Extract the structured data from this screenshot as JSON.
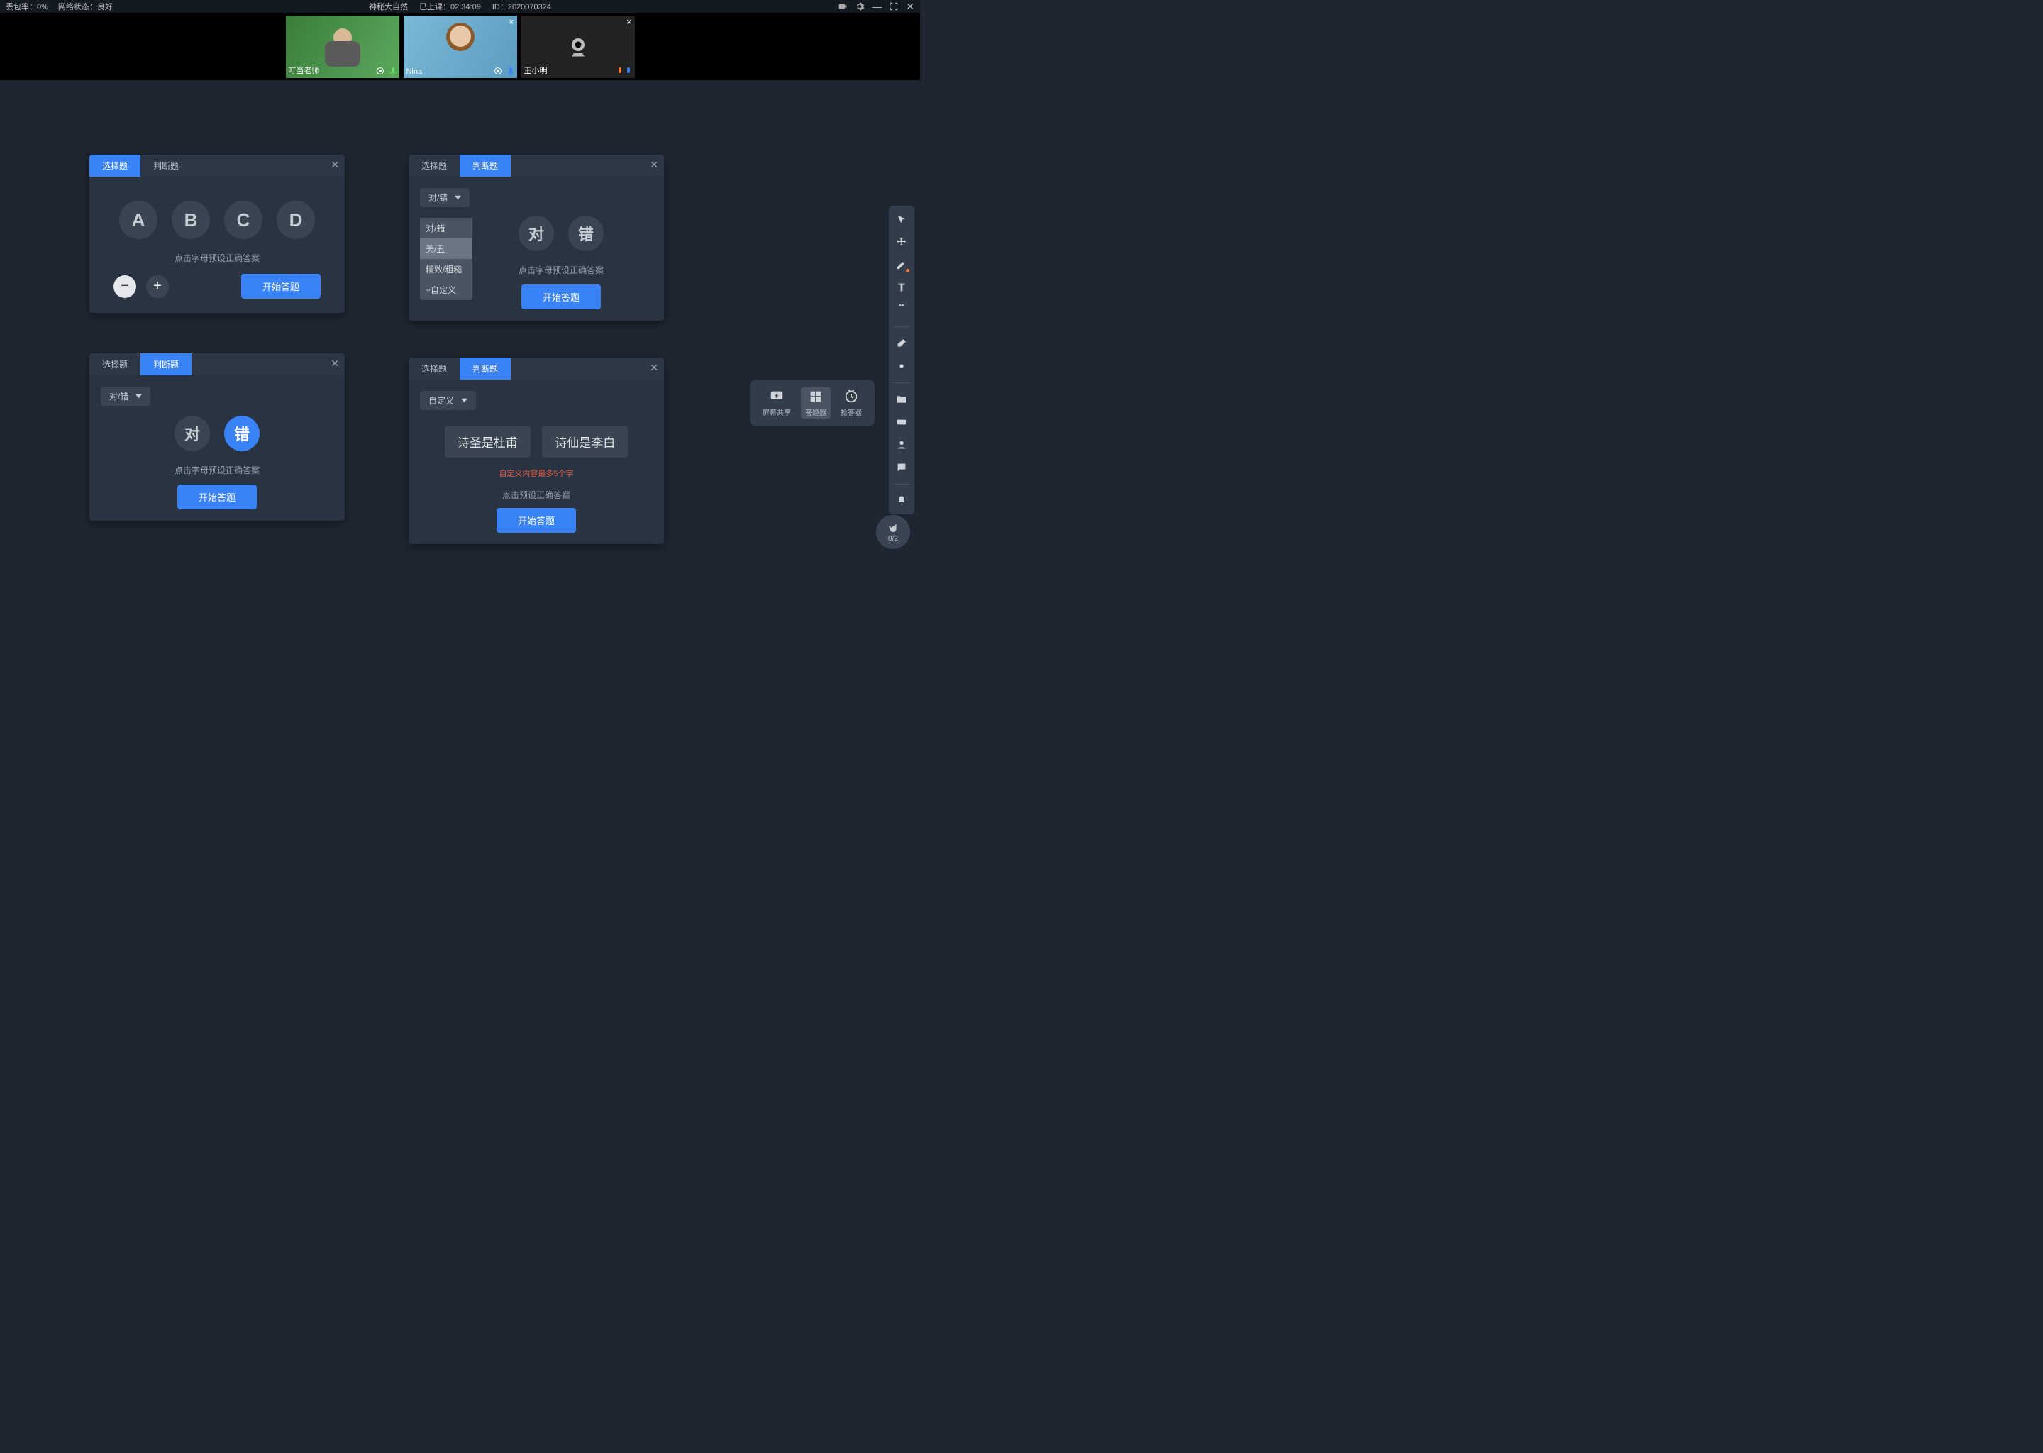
{
  "topbar": {
    "packet_loss_label": "丢包率：",
    "packet_loss_value": "0%",
    "network_label": "网络状态：",
    "network_value": "良好",
    "title": "神秘大自然",
    "class_time_label": "已上课：",
    "class_time_value": "02:34:09",
    "id_label": "ID：",
    "id_value": "2020070324"
  },
  "videos": [
    {
      "name": "叮当老师",
      "has_close": false,
      "camera_off": false,
      "mic_color": "#6bd66b"
    },
    {
      "name": "Nina",
      "has_close": true,
      "camera_off": false,
      "mic_color": "#3a82f7"
    },
    {
      "name": "王小明",
      "has_close": true,
      "camera_off": true,
      "mic_color": "#3a82f7"
    }
  ],
  "panel_labels": {
    "tab_choice": "选择题",
    "tab_judge": "判断题",
    "hint_click_letter": "点击字母预设正确答案",
    "hint_click_preset": "点击预设正确答案",
    "start": "开始答题",
    "custom_limit": "自定义内容最多5个字"
  },
  "panel1_options": [
    "A",
    "B",
    "C",
    "D"
  ],
  "dropdown_labels": {
    "true_false": "对/错",
    "custom": "自定义"
  },
  "dropdown_menu": [
    "对/错",
    "美/丑",
    "精致/粗糙",
    "+自定义"
  ],
  "true_false": {
    "true": "对",
    "false": "错"
  },
  "custom_chips": [
    "诗圣是杜甫",
    "诗仙是李白"
  ],
  "bottom_tools": {
    "screen_share": "屏幕共享",
    "answer_tool": "答题器",
    "quick_answer": "抢答器"
  },
  "hand_count": "0/2"
}
